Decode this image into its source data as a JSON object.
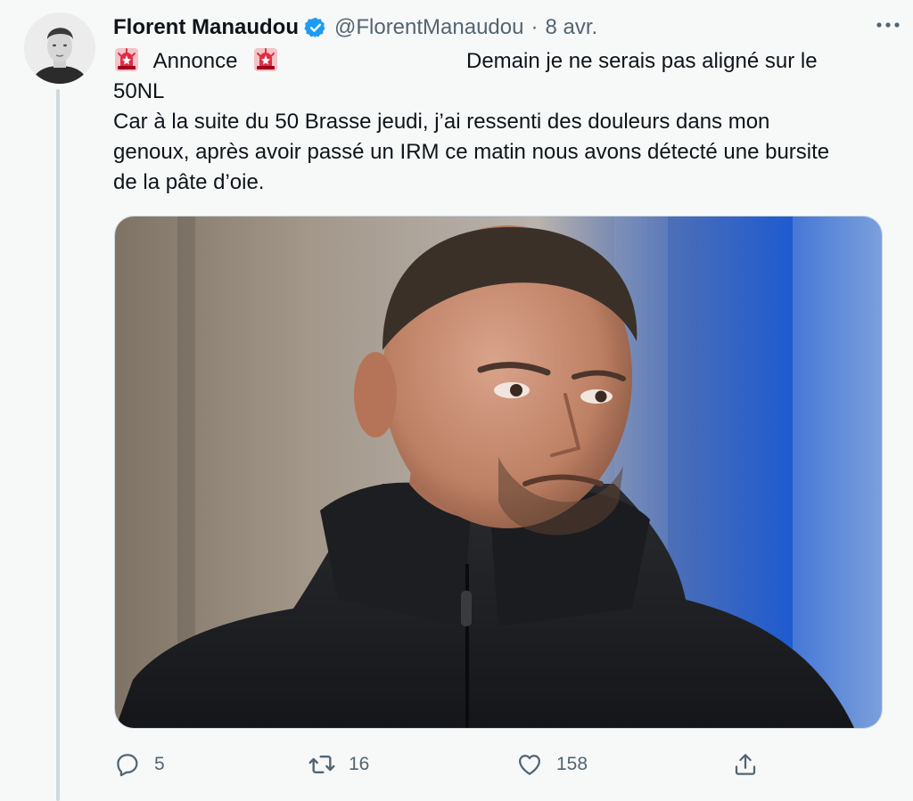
{
  "tweet": {
    "author": {
      "name": "Florent Manaudou",
      "handle": "@FlorentManaudou",
      "separator": "·",
      "date": "8 avr."
    },
    "text": {
      "line1_label": "Annonce",
      "line1_right": "Demain je ne serais pas aligné sur le",
      "line2": "50NL",
      "line3": "Car à la suite du 50 Brasse jeudi, j’ai ressenti des douleurs dans mon",
      "line4": "genoux, après avoir passé un IRM ce matin nous avons détecté une bursite",
      "line5": "de la pâte d’oie."
    },
    "actions": {
      "reply_count": "5",
      "retweet_count": "16",
      "like_count": "158"
    },
    "icons": {
      "verified": "verified-badge-icon",
      "more": "more-options-icon",
      "siren": "rotating-light-emoji",
      "reply": "reply-icon",
      "retweet": "retweet-icon",
      "like": "heart-icon",
      "share": "share-icon"
    },
    "colors": {
      "verified": "#1d9bf0",
      "secondary_text": "#536471",
      "primary_text": "#0f1419",
      "background": "#f7f9f9"
    }
  }
}
